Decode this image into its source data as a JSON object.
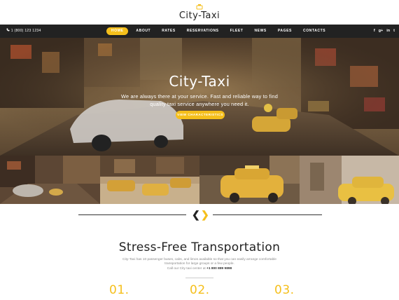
{
  "logo": {
    "text": "City-Taxi",
    "icon": "taxi-cap-icon"
  },
  "navbar": {
    "phone": "1 (800) 123 1234",
    "menu": [
      "HOME",
      "ABOUT",
      "RATES",
      "RESERVATIONS",
      "FLEET",
      "NEWS",
      "PAGES",
      "CONTACTS"
    ],
    "active_index": 0,
    "socials": [
      "f",
      "g+",
      "in",
      "t"
    ]
  },
  "hero": {
    "title": "City-Taxi",
    "subtitle": "We are always there at your service. Fast and reliable way to find quality taxi service anywhere you need it.",
    "button": "VIEW CHARACTERISTICS"
  },
  "gallery": [
    "street-traffic-photo",
    "taxis-crossing-photo",
    "yellow-taxi-photo",
    "parked-taxi-photo"
  ],
  "slider": {
    "prev": "❮",
    "next": "❯"
  },
  "section": {
    "title": "Stress-Free Transportation",
    "text_1": "City-Taxi has 10 passenger buses, cabs, and limos available so that you can easily arrange comfortable transportation for large groups or a few people.",
    "text_2": "Call our City taxi center at ",
    "phone": "+1 800 889 9898",
    "numbers": [
      "01.",
      "02.",
      "03."
    ]
  },
  "colors": {
    "accent": "#f5bf1b",
    "nav_bg": "#222222"
  }
}
